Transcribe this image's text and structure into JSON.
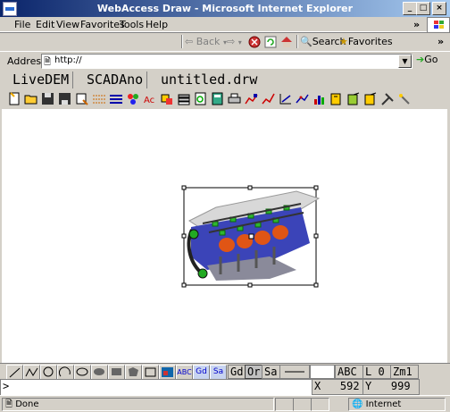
{
  "window": {
    "title": "WebAccess Draw - Microsoft Internet Explorer",
    "min": "_",
    "max": "□",
    "close": "×"
  },
  "menu": {
    "file": "File",
    "edit": "Edit",
    "view": "View",
    "favorites": "Favorites",
    "tools": "Tools",
    "help": "Help",
    "more": "»"
  },
  "toolbar": {
    "back": "Back",
    "search": "Search",
    "favorites": "Favorites",
    "more": "»"
  },
  "address": {
    "label": "Address",
    "value": "http://",
    "go": "Go"
  },
  "tabs": [
    "LiveDEM",
    "SCADAno",
    "untitled.drw"
  ],
  "drawbar": {
    "text_abc": "ABC",
    "text_gd": "Gd",
    "text_sa": "Sa",
    "gd": "Gd",
    "or": "Or",
    "sa": "Sa",
    "font_label": "ABC",
    "layer": "L 0",
    "zoom": "Zm1"
  },
  "command": {
    "prompt": ">"
  },
  "coords": {
    "x_label": "X",
    "x_value": "592",
    "y_label": "Y",
    "y_value": "999"
  },
  "status": {
    "text": "Done",
    "zone": "Internet"
  }
}
